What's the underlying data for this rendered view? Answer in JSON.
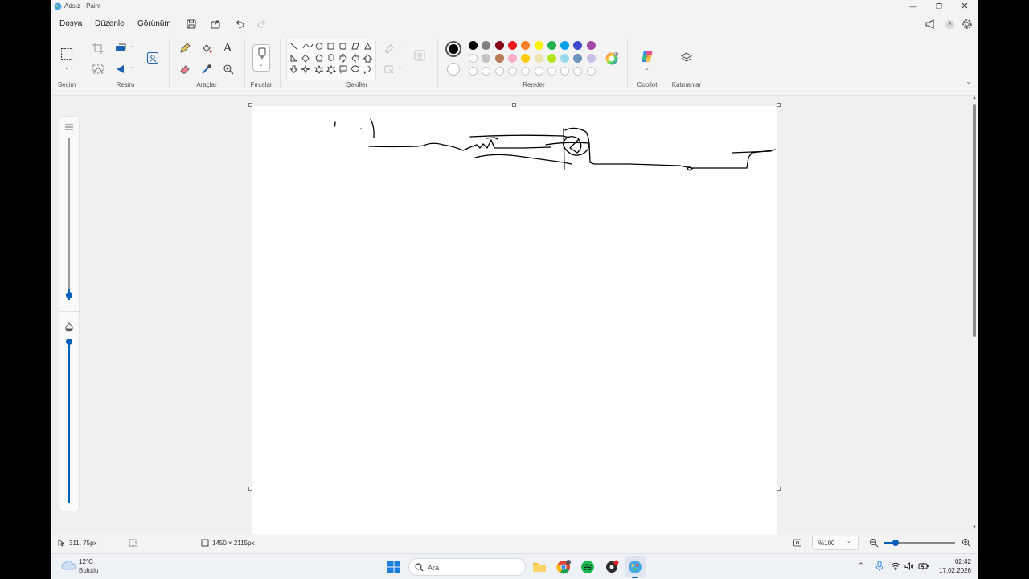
{
  "window": {
    "title": "Adsız - Paint"
  },
  "menu": {
    "file": "Dosya",
    "edit": "Düzenle",
    "view": "Görünüm"
  },
  "ribbon": {
    "groups": {
      "selection": "Seçim",
      "image": "Resim",
      "tools": "Araçlar",
      "brushes": "Fırçalar",
      "shapes": "Şekiller",
      "colors": "Renkler",
      "copilot": "Copilot",
      "layers": "Katmanlar"
    },
    "tool_text_glyph": "A",
    "palette_row1": [
      "#000000",
      "#7f7f7f",
      "#880015",
      "#ed1c24",
      "#ff7f27",
      "#fff200",
      "#22b14c",
      "#00a2e8",
      "#3f48cc",
      "#a349a4"
    ],
    "palette_row2": [
      "#ffffff",
      "#c3c3c3",
      "#b97a57",
      "#ffaec9",
      "#ffc90e",
      "#efe4b0",
      "#b5e61d",
      "#99d9ea",
      "#7092be",
      "#c8bfe7"
    ],
    "primary_color": "#000000",
    "secondary_color": "#ffffff"
  },
  "status": {
    "cursor_pos": "311, 75px",
    "canvas_size": "1450 × 2115px",
    "zoom": "%100"
  },
  "taskbar": {
    "weather_temp": "12°C",
    "weather_desc": "Bulutlu",
    "search_placeholder": "Ara",
    "time": "02:42",
    "date": "17.02.2026"
  },
  "colors": {
    "accent": "#005fb8"
  }
}
